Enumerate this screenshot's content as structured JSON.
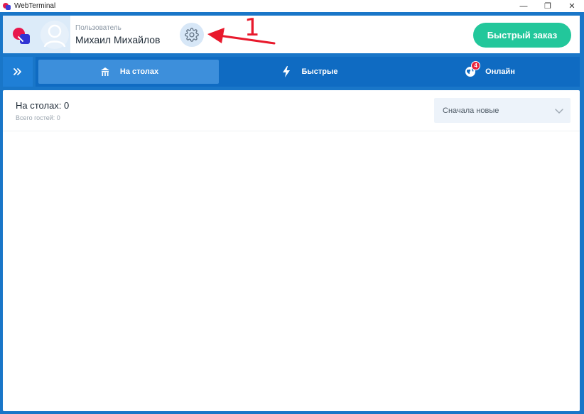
{
  "window": {
    "title": "WebTerminal",
    "controls": {
      "minimize": "—",
      "maximize": "❐",
      "close": "✕"
    }
  },
  "header": {
    "user_caption": "Пользователь",
    "user_name": "Михаил Михайлов",
    "settings_icon": "gear-icon",
    "quick_order_label": "Быстрый заказ",
    "annotation_number": "1"
  },
  "nav": {
    "expand_icon": "double-chevron-right-icon",
    "tabs": [
      {
        "label": "На столах",
        "icon": "tables-icon",
        "active": true
      },
      {
        "label": "Быстрые",
        "icon": "lightning-icon",
        "active": false
      },
      {
        "label": "Онлайн",
        "icon": "globe-icon",
        "active": false,
        "badge": "4"
      }
    ]
  },
  "content": {
    "tables_count": "На столах: 0",
    "guests_count": "Всего гостей: 0",
    "sort": {
      "value": "Сначала новые"
    }
  },
  "colors": {
    "frame": "#1976c8",
    "tab_bar": "#0f6bc2",
    "tab_active": "#3d8fdb",
    "accent_green": "#22c79b",
    "badge_red": "#e8253d",
    "annotation_red": "#e8192c"
  }
}
